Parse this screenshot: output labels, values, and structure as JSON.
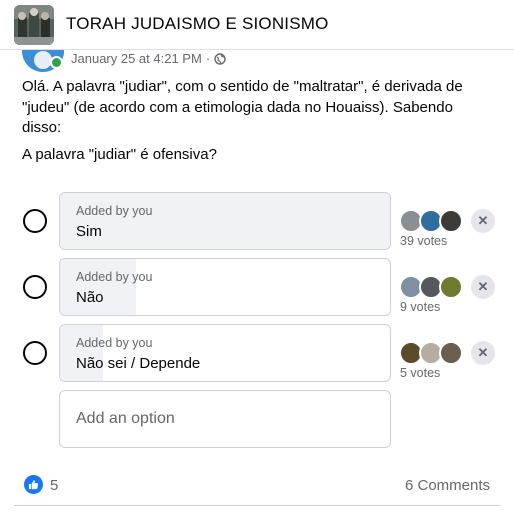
{
  "group": {
    "title": "TORAH JUDAISMO E SIONISMO",
    "avatar_icon": "group-photo"
  },
  "post": {
    "timestamp": "January 25 at 4:21 PM",
    "separator": "·",
    "privacy_icon": "globe-icon",
    "text": "Olá. A palavra \"judiar\", com o sentido de \"maltratar\", é derivada de \"judeu\" (de acordo com a etimologia dada no Houaiss). Sabendo disso:",
    "question": "A palavra \"judiar\" é ofensiva?"
  },
  "poll": {
    "options": [
      {
        "added_by": "Added by you",
        "label": "Sim",
        "votes": "39 votes",
        "vote_share": 1.0
      },
      {
        "added_by": "Added by you",
        "label": "Não",
        "votes": "9 votes",
        "vote_share": 0.23
      },
      {
        "added_by": "Added by you",
        "label": "Não sei / Depende",
        "votes": "5 votes",
        "vote_share": 0.13
      }
    ],
    "add_option_placeholder": "Add an option",
    "remove_symbol": "✕"
  },
  "footer": {
    "like_count": "5",
    "comments": "6 Comments"
  },
  "colors": {
    "accent": "#1877f2",
    "online": "#31a24c",
    "muted_text": "#65676b",
    "bar_fill": "#f0f2f5"
  }
}
